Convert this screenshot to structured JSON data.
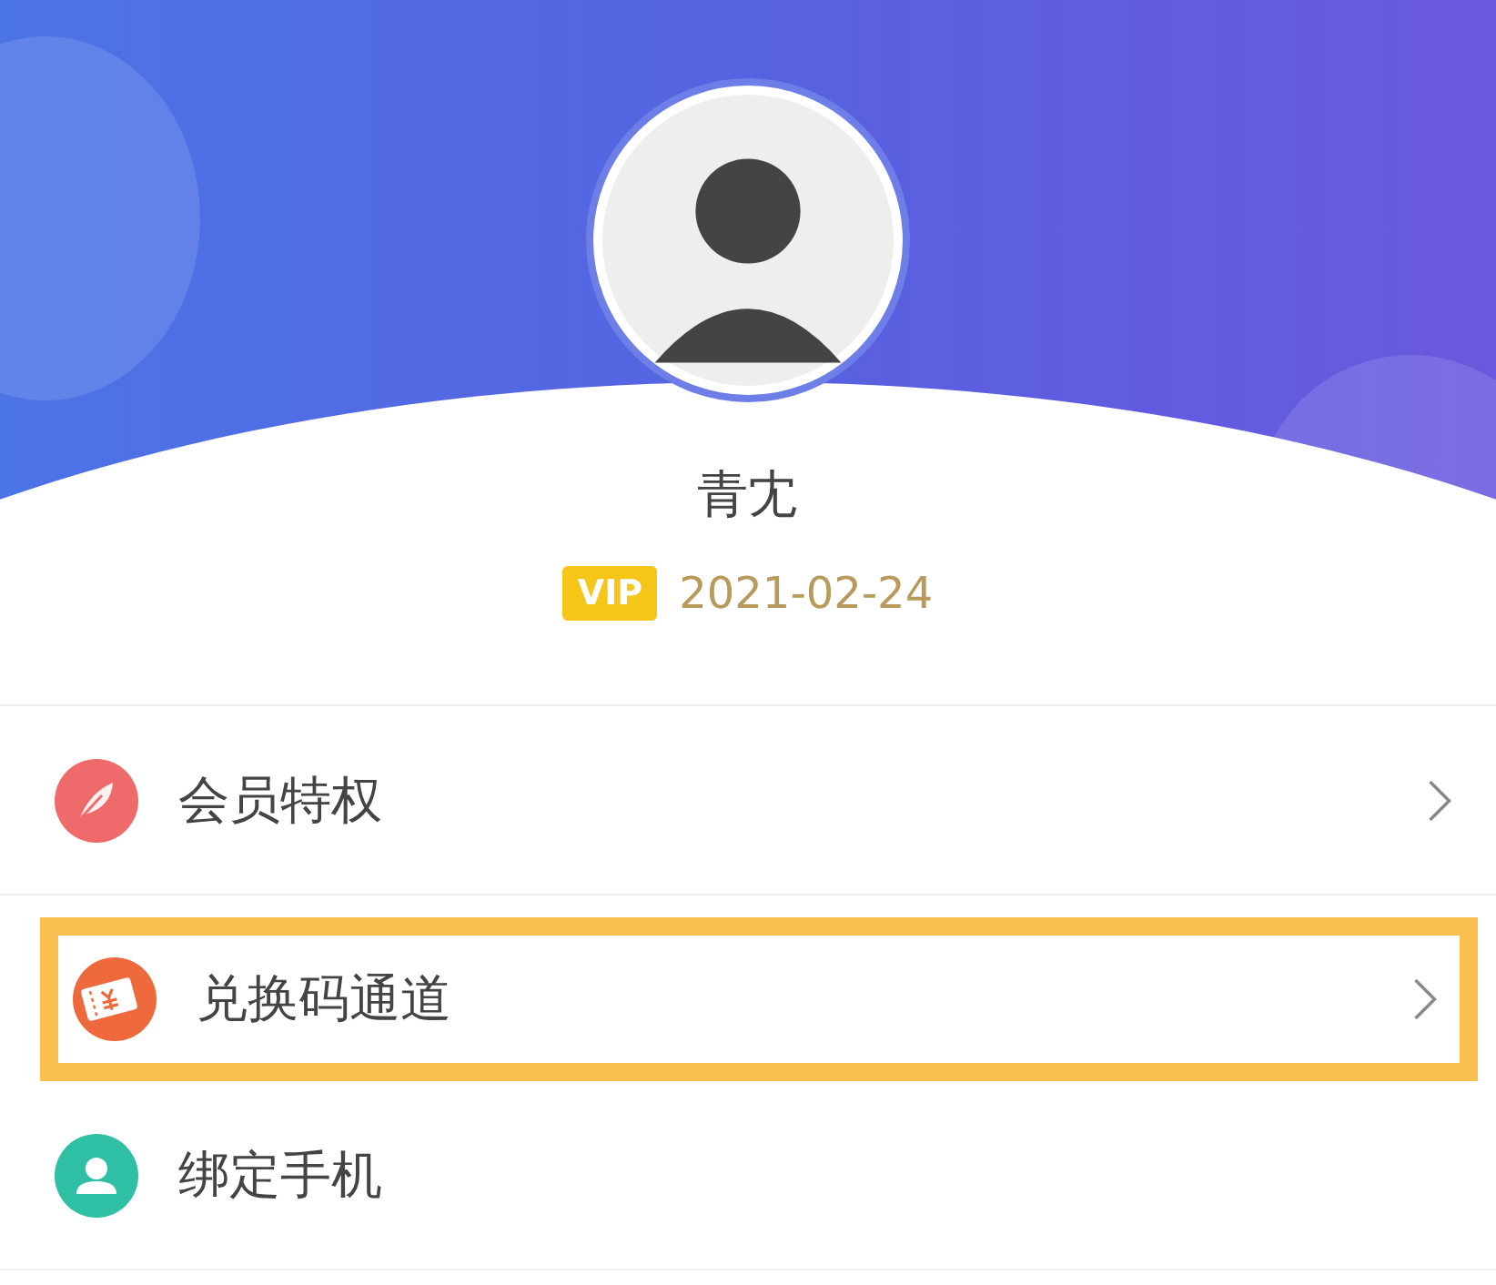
{
  "profile": {
    "name": "青冘",
    "vip_badge": "VIP",
    "vip_expiry": "2021-02-24"
  },
  "menu": [
    {
      "kind": "feather",
      "label": "会员特权",
      "highlighted": false,
      "chevron": true
    },
    {
      "kind": "ticket",
      "label": "兑换码通道",
      "highlighted": true,
      "chevron": true
    },
    {
      "kind": "person",
      "label": "绑定手机",
      "highlighted": false,
      "chevron": false
    }
  ]
}
